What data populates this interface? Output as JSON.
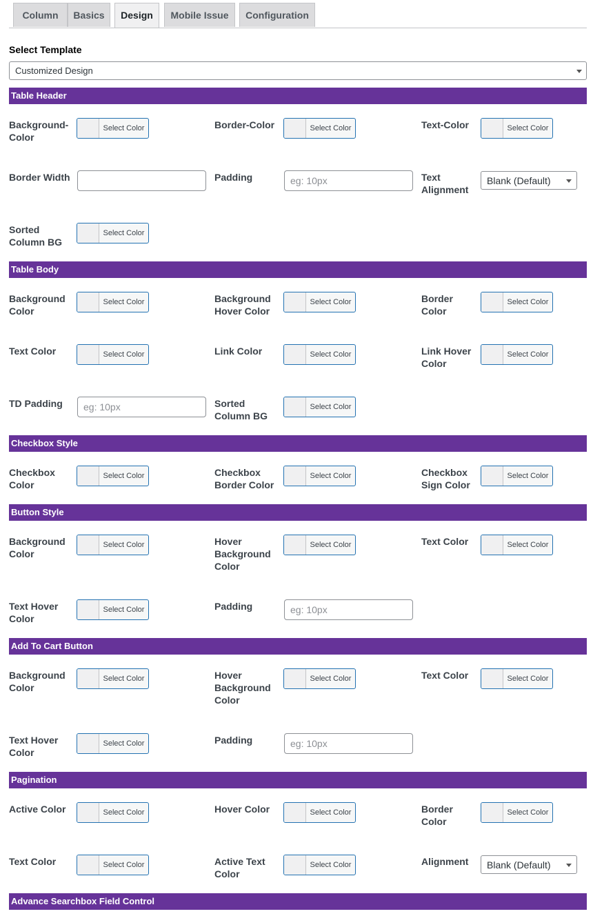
{
  "tabs": [
    "Column",
    "Basics",
    "Design",
    "Mobile Issue",
    "Configuration"
  ],
  "active_tab": "Design",
  "template": {
    "title": "Select Template",
    "value": "Customized Design"
  },
  "color_button_label": "Select Color",
  "sections": {
    "table_header": {
      "title": "Table Header",
      "bg_color": "Background-\nColor",
      "border_color": "Border-Color",
      "text_color": "Text-Color",
      "border_width": "Border Width",
      "border_width_value": "",
      "padding": "Padding",
      "padding_placeholder": "eg: 10px",
      "text_alignment": "Text\nAlignment",
      "text_alignment_value": "Blank (Default)",
      "sorted_bg": "Sorted\nColumn BG"
    },
    "table_body": {
      "title": "Table Body",
      "bg_color": "Background\nColor",
      "bg_hover": "Background\nHover Color",
      "border_color": "Border\nColor",
      "text_color": "Text Color",
      "link_color": "Link Color",
      "link_hover": "Link Hover\nColor",
      "td_padding": "TD Padding",
      "td_padding_placeholder": "eg: 10px",
      "sorted_bg": "Sorted\nColumn BG"
    },
    "checkbox": {
      "title": "Checkbox Style",
      "color": "Checkbox\nColor",
      "border_color": "Checkbox\nBorder Color",
      "sign_color": "Checkbox\nSign Color"
    },
    "button": {
      "title": "Button Style",
      "bg_color": "Background\nColor",
      "hover_bg": "Hover\nBackground\nColor",
      "text_color": "Text Color",
      "text_hover": "Text Hover\nColor",
      "padding": "Padding",
      "padding_placeholder": "eg: 10px"
    },
    "add_to_cart": {
      "title": "Add To Cart Button",
      "bg_color": "Background\nColor",
      "hover_bg": "Hover\nBackground\nColor",
      "text_color": "Text Color",
      "text_hover": "Text Hover\nColor",
      "padding": "Padding",
      "padding_placeholder": "eg: 10px"
    },
    "pagination": {
      "title": "Pagination",
      "active_color": "Active Color",
      "hover_color": "Hover Color",
      "border_color": "Border\nColor",
      "text_color": "Text Color",
      "active_text": "Active Text\nColor",
      "alignment": "Alignment",
      "alignment_value": "Blank (Default)"
    },
    "advance_search": {
      "title": "Advance Searchbox Field Control"
    }
  },
  "colors": {
    "section_bar": "#663399",
    "button_border": "#2271b1"
  }
}
